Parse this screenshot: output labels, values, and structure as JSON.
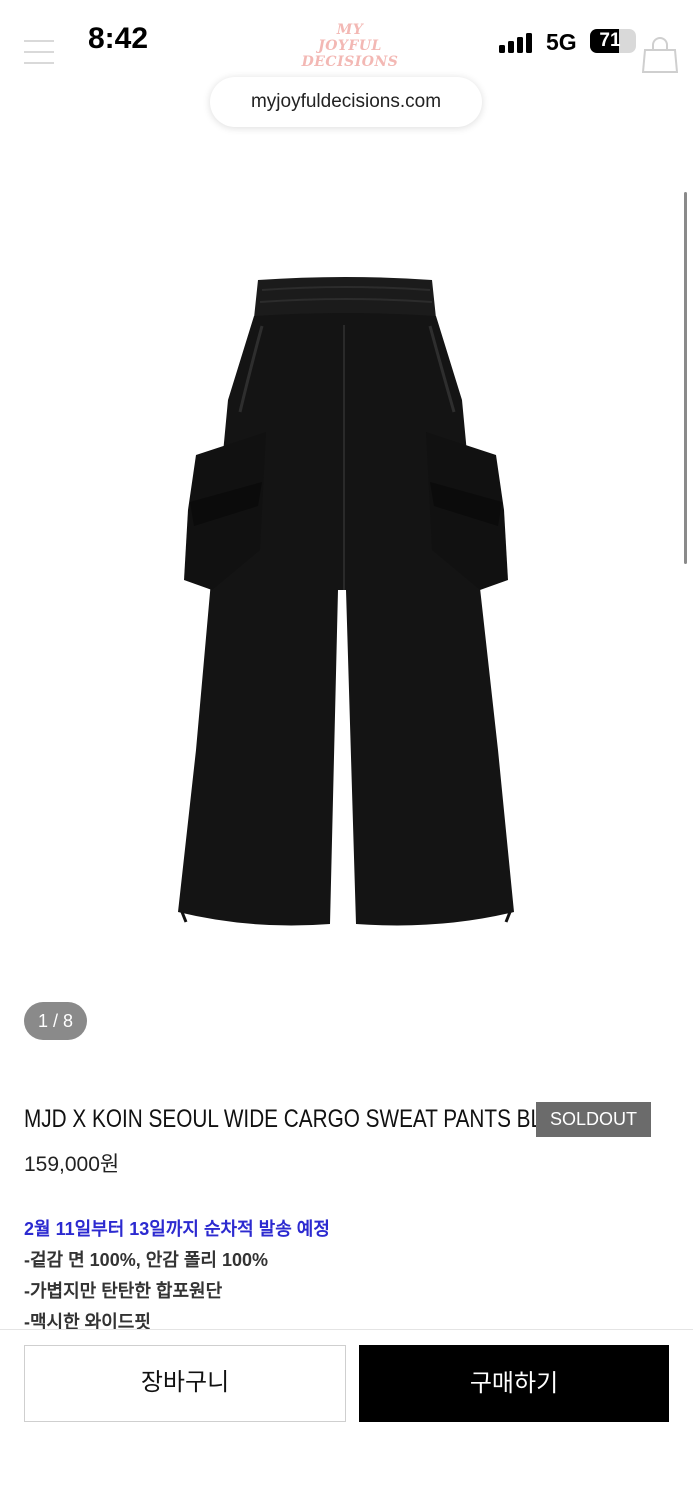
{
  "status_bar": {
    "time": "8:42",
    "network": "5G",
    "battery_percent": 71,
    "battery_text": "71"
  },
  "header": {
    "logo_text": "MY\nJOYFUL\nDECISIONS",
    "url": "myjoyfuldecisions.com",
    "menu_icon": "hamburger-icon",
    "cart_icon": "shopping-bag-icon"
  },
  "gallery": {
    "counter": "1 / 8",
    "image_alt": "black wide cargo sweat pants"
  },
  "product": {
    "title": "MJD X KOIN SEOUL WIDE CARGO SWEAT PANTS BLACK",
    "badge": "SOLDOUT",
    "price": "159,000원",
    "description": [
      "2월 11일부터 13일까지 순차적 발송 예정",
      "-겉감 면 100%, 안감 폴리 100%",
      "-가볍지만 탄탄한 합포원단",
      "-맥시한 와이드핏"
    ]
  },
  "actions": {
    "cart_label": "장바구니",
    "buy_label": "구매하기"
  },
  "colors": {
    "highlight": "#2c2ad0",
    "badge_bg": "#6b6b6b",
    "buy_bg": "#000000",
    "logo_pink": "#f3b8b4"
  }
}
